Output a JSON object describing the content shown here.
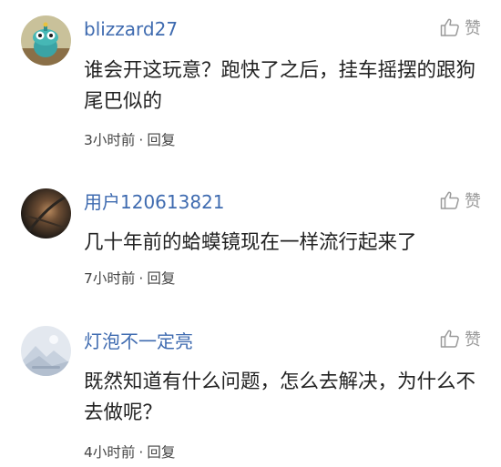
{
  "comments": [
    {
      "username": "blizzard27",
      "avatar_icon": "cartoon-robot-avatar",
      "text": "谁会开这玩意？跑快了之后，挂车摇摆的跟狗尾巴似的",
      "time": "3小时前",
      "separator": "·",
      "reply_label": "回复",
      "like_label": "赞",
      "like_icon": "thumbs-up-icon"
    },
    {
      "username": "用户120613821",
      "avatar_icon": "dark-photo-avatar",
      "text": "几十年前的蛤蟆镜现在一样流行起来了",
      "time": "7小时前",
      "separator": "·",
      "reply_label": "回复",
      "like_label": "赞",
      "like_icon": "thumbs-up-icon"
    },
    {
      "username": "灯泡不一定亮",
      "avatar_icon": "landscape-placeholder-avatar",
      "text": "既然知道有什么问题，怎么去解决，为什么不去做呢？",
      "time": "4小时前",
      "separator": "·",
      "reply_label": "回复",
      "like_label": "赞",
      "like_icon": "thumbs-up-icon"
    }
  ],
  "colors": {
    "username": "#3f6bb0",
    "text": "#222222",
    "meta": "#444444",
    "icon": "#9a9a9a"
  }
}
